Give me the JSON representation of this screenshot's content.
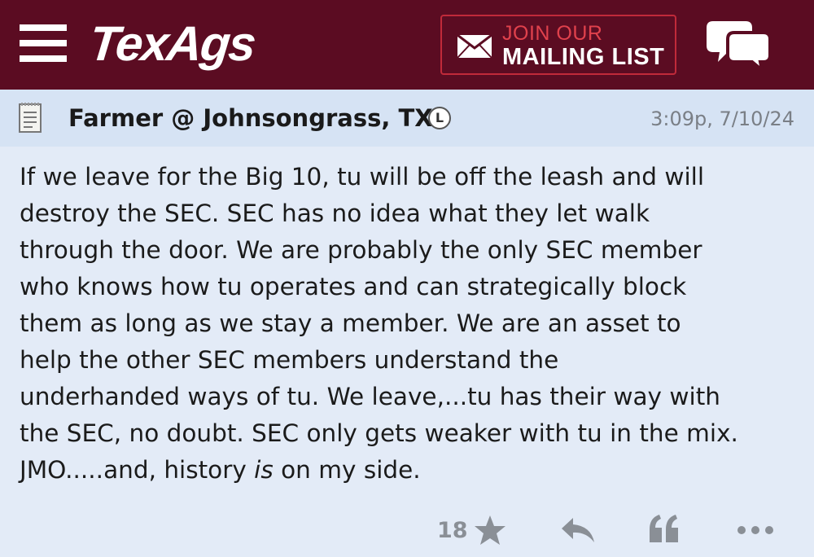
{
  "header": {
    "logo_text": "TexAgs",
    "mailing": {
      "line1": "JOIN OUR",
      "line2": "MAILING LIST"
    },
    "menu_icon": "hamburger-menu-icon",
    "mail_icon": "envelope-icon",
    "chat_icon": "chat-bubbles-icon",
    "colors": {
      "bar": "#5b0c22",
      "mailing_border": "#c02a3a",
      "mailing_accent": "#e0414c"
    }
  },
  "post": {
    "author": "Farmer @ Johnsongrass, TX",
    "badge": "L",
    "timestamp": "3:09p, 7/10/24",
    "body_lines": [
      "If we leave for the Big 10, tu will be off the leash and will",
      "destroy the SEC. SEC has no idea what they let walk",
      "through the door. We are probably the only SEC member",
      "who knows how tu operates and can strategically block",
      "them as long as we stay a member. We are an asset to",
      "help the other SEC members understand the",
      "underhanded ways of tu. We leave,...tu has their way with",
      "the SEC, no doubt. SEC only gets weaker with tu in the mix."
    ],
    "body_last": {
      "before": "JMO.....and, history ",
      "italic": "is",
      "after": " on my side."
    },
    "doc_icon": "document-icon"
  },
  "actions": {
    "star_count": "18",
    "icons": [
      "star-icon",
      "reply-icon",
      "quote-icon",
      "more-icon"
    ]
  }
}
